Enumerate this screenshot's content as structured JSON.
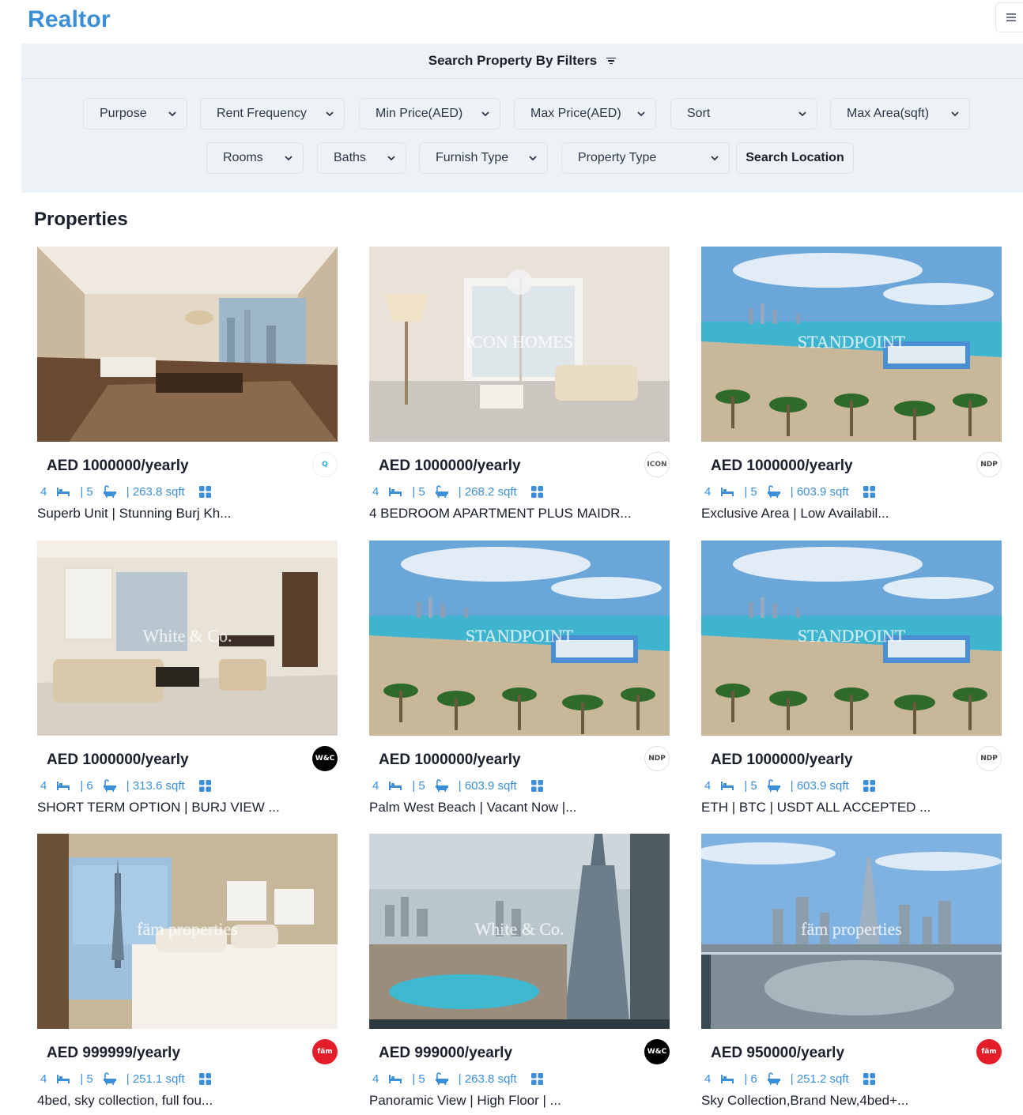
{
  "app": {
    "logo": "Realtor",
    "menu_icon": "hamburger-icon"
  },
  "filters": {
    "heading": "Search Property By Filters",
    "selects": [
      "Purpose",
      "Rent Frequency",
      "Min Price(AED)",
      "Max Price(AED)",
      "Sort",
      "Max Area(sqft)",
      "Rooms",
      "Baths",
      "Furnish Type",
      "Property Type"
    ],
    "search_location_label": "Search Location"
  },
  "section_title": "Properties",
  "colors": {
    "accent": "#3b8fd9",
    "panel": "#edf2f7"
  },
  "properties": [
    {
      "price": "AED 1000000/yearly",
      "rooms": "4",
      "baths": "| 5",
      "area": "| 263.8 sqft",
      "title": "Superb Unit | Stunning Burj Kh...",
      "agency_logo": "Q",
      "scene": "interior"
    },
    {
      "price": "AED 1000000/yearly",
      "rooms": "4",
      "baths": "| 5",
      "area": "| 268.2 sqft",
      "title": "4 BEDROOM APARTMENT PLUS MAIDR...",
      "agency_logo": "ICON HOMES",
      "scene": "interior-light",
      "watermark": "ICON HOMES"
    },
    {
      "price": "AED 1000000/yearly",
      "rooms": "4",
      "baths": "| 5",
      "area": "| 603.9 sqft",
      "title": "Exclusive Area | Low Availabil...",
      "agency_logo": "NDP",
      "scene": "beach",
      "watermark": "STANDPOINT"
    },
    {
      "price": "AED 1000000/yearly",
      "rooms": "4",
      "baths": "| 6",
      "area": "| 313.6 sqft",
      "title": "SHORT TERM OPTION | BURJ VIEW ...",
      "agency_logo": "White & Co",
      "scene": "living",
      "watermark": "White & Co."
    },
    {
      "price": "AED 1000000/yearly",
      "rooms": "4",
      "baths": "| 5",
      "area": "| 603.9 sqft",
      "title": "Palm West Beach | Vacant Now |...",
      "agency_logo": "NDP",
      "scene": "beach",
      "watermark": "STANDPOINT"
    },
    {
      "price": "AED 1000000/yearly",
      "rooms": "4",
      "baths": "| 5",
      "area": "| 603.9 sqft",
      "title": "ETH | BTC | USDT ALL ACCEPTED ...",
      "agency_logo": "NDP",
      "scene": "beach",
      "watermark": "STANDPOINT"
    },
    {
      "price": "AED 999999/yearly",
      "rooms": "4",
      "baths": "| 5",
      "area": "| 251.1 sqft",
      "title": "4bed, sky collection, full fou...",
      "agency_logo": "fäm",
      "scene": "bedroom",
      "watermark": "fäm properties"
    },
    {
      "price": "AED 999000/yearly",
      "rooms": "4",
      "baths": "| 5",
      "area": "| 263.8 sqft",
      "title": "Panoramic View | High Floor | ...",
      "agency_logo": "White & Co",
      "scene": "city",
      "watermark": "White & Co."
    },
    {
      "price": "AED 950000/yearly",
      "rooms": "4",
      "baths": "| 6",
      "area": "| 251.2 sqft",
      "title": "Sky Collection,Brand New,4bed+...",
      "agency_logo": "fäm",
      "scene": "skyline",
      "watermark": "fäm properties"
    }
  ]
}
